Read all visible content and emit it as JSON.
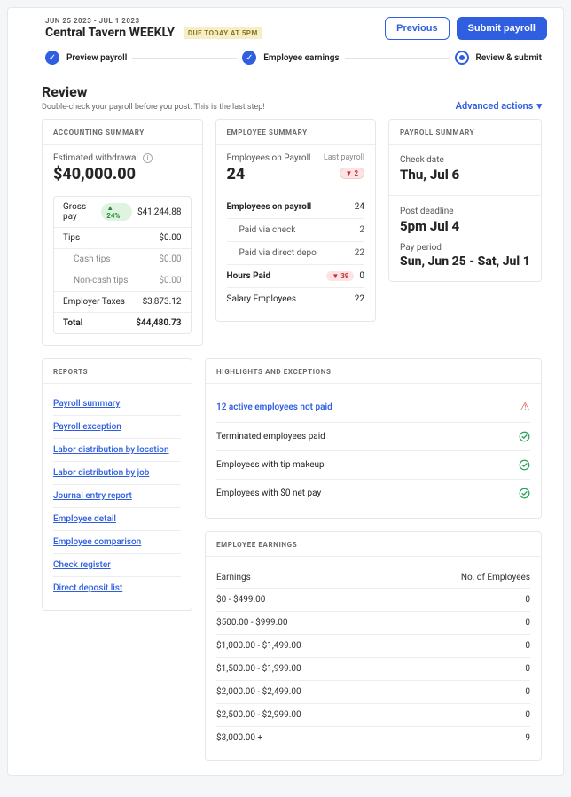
{
  "header": {
    "date_range": "JUN 25 2023 - JUL 1 2023",
    "title": "Central Tavern WEEKLY",
    "due_badge": "DUE TODAY AT 5PM",
    "previous_btn": "Previous",
    "submit_btn": "Submit payroll"
  },
  "stepper": {
    "step1": "Preview payroll",
    "step2": "Employee earnings",
    "step3": "Review & submit"
  },
  "review": {
    "heading": "Review",
    "sub": "Double-check your payroll before you post. This is the last step!",
    "advanced_actions": "Advanced actions"
  },
  "accounting": {
    "title": "ACCOUNTING SUMMARY",
    "withdrawal_label": "Estimated withdrawal",
    "withdrawal_amount": "$40,000.00",
    "rows": {
      "gross_label": "Gross pay",
      "gross_chip": "▲ 24%",
      "gross_value": "$41,244.88",
      "tips_label": "Tips",
      "tips_value": "$0.00",
      "cash_tips_label": "Cash tips",
      "cash_tips_value": "$0.00",
      "noncash_tips_label": "Non-cash tips",
      "noncash_tips_value": "$0.00",
      "employer_taxes_label": "Employer Taxes",
      "employer_taxes_value": "$3,873.12",
      "total_label": "Total",
      "total_value": "$44,480.73"
    }
  },
  "employee_summary": {
    "title": "EMPLOYEE SUMMARY",
    "count_label": "Employees on Payroll",
    "count_value": "24",
    "last_payroll_label": "Last payroll",
    "last_payroll_chip": "▼ 2",
    "rows": {
      "on_payroll_label": "Employees on payroll",
      "on_payroll_value": "24",
      "paid_check_label": "Paid via check",
      "paid_check_value": "2",
      "paid_depo_label": "Paid via direct depo",
      "paid_depo_value": "22",
      "hours_paid_label": "Hours Paid",
      "hours_paid_chip": "▼ 39",
      "hours_paid_value": "0",
      "salary_label": "Salary Employees",
      "salary_value": "22"
    }
  },
  "payroll_summary": {
    "title": "PAYROLL SUMMARY",
    "check_date_label": "Check date",
    "check_date_value": "Thu, Jul 6",
    "deadline_label": "Post deadline",
    "deadline_value": "5pm Jul 4",
    "period_label": "Pay period",
    "period_value": "Sun, Jun 25 - Sat, Jul 1"
  },
  "reports": {
    "title": "REPORTS",
    "items": [
      "Payroll summary",
      "Payroll exception",
      "Labor distribution by location",
      "Labor distribution by job",
      "Journal entry report",
      "Employee detail",
      "Employee comparison",
      "Check register",
      "Direct deposit list"
    ]
  },
  "highlights": {
    "title": "HIGHLIGHTS AND EXCEPTIONS",
    "rows": [
      {
        "label": "12 active employees not paid",
        "link": true,
        "status": "warn"
      },
      {
        "label": "Terminated employees paid",
        "link": false,
        "status": "ok"
      },
      {
        "label": "Employees with tip makeup",
        "link": false,
        "status": "ok"
      },
      {
        "label": "Employees with $0 net pay",
        "link": false,
        "status": "ok"
      }
    ]
  },
  "earnings": {
    "title": "EMPLOYEE EARNINGS",
    "col_earnings": "Earnings",
    "col_count": "No. of Employees",
    "rows": [
      {
        "range": "$0 -  $499.00",
        "count": "0"
      },
      {
        "range": "$500.00 -  $999.00",
        "count": "0"
      },
      {
        "range": "$1,000.00 -  $1,499.00",
        "count": "0"
      },
      {
        "range": "$1,500.00 -  $1,999.00",
        "count": "0"
      },
      {
        "range": "$2,000.00 -  $2,499.00",
        "count": "0"
      },
      {
        "range": "$2,500.00 -  $2,999.00",
        "count": "0"
      },
      {
        "range": "$3,000.00 +",
        "count": "9"
      }
    ]
  }
}
